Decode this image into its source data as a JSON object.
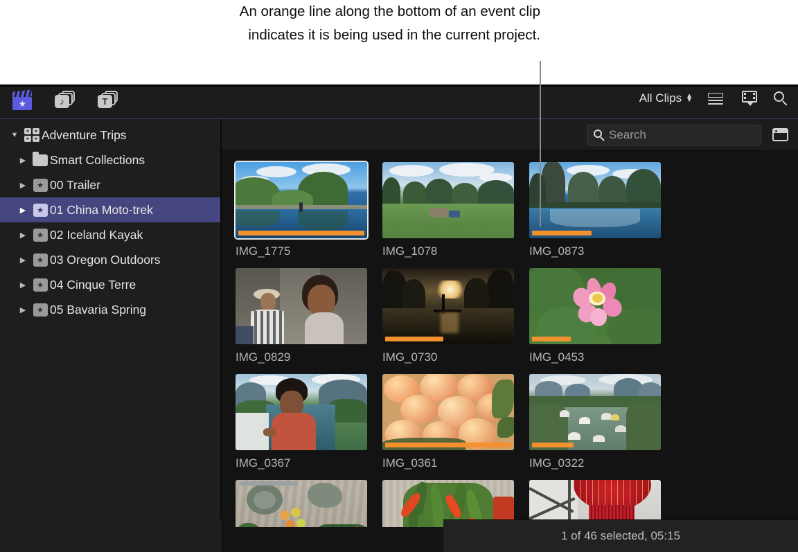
{
  "annotation": {
    "text": "An orange line along the bottom of an event clip indicates it is being used in the current project.",
    "line_color": "#8a8a8a"
  },
  "toolbar": {
    "left_icons": [
      {
        "name": "libraries-icon",
        "label": "Libraries",
        "selected": true
      },
      {
        "name": "photos-audio-icon",
        "label": "Photos and Audio",
        "glyph": "♪"
      },
      {
        "name": "titles-generators-icon",
        "label": "Titles and Generators",
        "glyph": "T"
      }
    ],
    "clip_filter_label": "All Clips",
    "right_icons": [
      {
        "name": "list-view-icon",
        "label": "List View"
      },
      {
        "name": "filmstrip-view-icon",
        "label": "Filmstrip View"
      },
      {
        "name": "search-icon",
        "label": "Search"
      }
    ]
  },
  "sidebar": {
    "items": [
      {
        "label": "Adventure Trips",
        "level": 1,
        "icon": "library-icon",
        "expanded": true,
        "selected": false
      },
      {
        "label": "Smart Collections",
        "level": 2,
        "icon": "folder-icon",
        "expanded": false,
        "selected": false
      },
      {
        "label": "00 Trailer",
        "level": 2,
        "icon": "event-icon",
        "expanded": false,
        "selected": false
      },
      {
        "label": "01 China Moto-trek",
        "level": 2,
        "icon": "event-icon",
        "expanded": false,
        "selected": true
      },
      {
        "label": "02 Iceland Kayak",
        "level": 2,
        "icon": "event-icon",
        "expanded": false,
        "selected": false
      },
      {
        "label": "03 Oregon Outdoors",
        "level": 2,
        "icon": "event-icon",
        "expanded": false,
        "selected": false
      },
      {
        "label": "04 Cinque Terre",
        "level": 2,
        "icon": "event-icon",
        "expanded": false,
        "selected": false
      },
      {
        "label": "05 Bavaria Spring",
        "level": 2,
        "icon": "event-icon",
        "expanded": false,
        "selected": false
      }
    ],
    "selection_color": "#45457f"
  },
  "browser": {
    "search": {
      "placeholder": "Search",
      "value": ""
    },
    "panel_toggle_name": "clip-appearance-icon",
    "orange_bar_color": "#f3912e",
    "rows": [
      [
        {
          "name": "IMG_1775",
          "selected": true,
          "used_percent": 100,
          "scene": "karst-lake-swimmer"
        },
        {
          "name": "IMG_1078",
          "selected": false,
          "used_percent": 0,
          "scene": "karst-village"
        },
        {
          "name": "IMG_0873",
          "selected": false,
          "used_percent": 47,
          "scene": "karst-reflection"
        }
      ],
      [
        {
          "name": "IMG_0829",
          "selected": false,
          "used_percent": 0,
          "scene": "two-women-cliff"
        },
        {
          "name": "IMG_0730",
          "selected": false,
          "used_percent": 46,
          "scene": "sunset-boat"
        },
        {
          "name": "IMG_0453",
          "selected": false,
          "used_percent": 31,
          "scene": "lotus-flower"
        }
      ],
      [
        {
          "name": "IMG_0367",
          "selected": false,
          "used_percent": 0,
          "scene": "man-river-bamboo"
        },
        {
          "name": "IMG_0361",
          "selected": false,
          "used_percent": 100,
          "scene": "peaches-market"
        },
        {
          "name": "IMG_0322",
          "selected": false,
          "used_percent": 33,
          "scene": "river-rafts"
        }
      ],
      [
        {
          "name": "",
          "selected": false,
          "used_percent": 0,
          "scene": "market-vegetables"
        },
        {
          "name": "",
          "selected": false,
          "used_percent": 0,
          "scene": "green-chilies"
        },
        {
          "name": "",
          "selected": false,
          "used_percent": 0,
          "scene": "red-lantern"
        }
      ]
    ]
  },
  "status": {
    "text": "1 of 46 selected, 05:15"
  }
}
